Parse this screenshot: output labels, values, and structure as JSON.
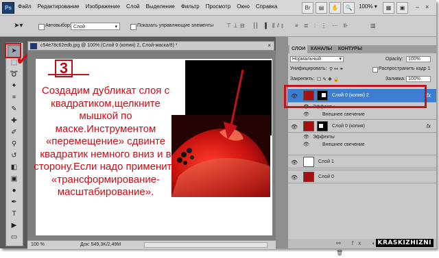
{
  "app": {
    "logo": "Ps"
  },
  "menu": [
    "Файл",
    "Редактирование",
    "Изображение",
    "Слой",
    "Выделение",
    "Фильтр",
    "Просмотр",
    "Окно",
    "Справка"
  ],
  "menubar_right": {
    "zoom": "100%",
    "minimize": "–",
    "close": "×"
  },
  "options": {
    "autoselect_label": "Автовыбор:",
    "autoselect_value": "Слой",
    "show_controls_label": "Показать управляющие элементы"
  },
  "document": {
    "tab_title": "c54e78c62edb.jpg @ 100% (Слой 0 (копия) 2, Слой-маска/8) *",
    "step_number": "3",
    "instruction": "Создадим дубликат слоя с квадратиком,щелкните мышкой по маске.Инструментом «перемещение» сдвинте квадратик немного вниз и в сторону.Если надо примените «трансформирование-масштабирование».",
    "status_zoom": "100 %",
    "status_doc": "Док: 549,3K/2,49M"
  },
  "layers_panel": {
    "tabs": [
      "СЛОИ",
      "КАНАЛЫ",
      "КОНТУРЫ"
    ],
    "blend_mode": "Нормальный",
    "opacity_label": "Opacity:",
    "opacity_value": "100%",
    "unify_label": "Унифицировать:",
    "propagate_label": "Распространить кадр 1",
    "lock_label": "Закрепить:",
    "fill_label": "Заливка:",
    "fill_value": "100%",
    "layers": [
      {
        "name": "Слой 0 (копия) 2",
        "selected": true,
        "fx": "fx"
      },
      {
        "name": "Эффекты",
        "kind": "effects"
      },
      {
        "name": "Внешнее свечение",
        "kind": "effect"
      },
      {
        "name": "Слой 0 (копия)",
        "selected": false,
        "fx": "fx"
      },
      {
        "name": "Эффекты",
        "kind": "effects"
      },
      {
        "name": "Внешнее свечение",
        "kind": "effect"
      },
      {
        "name": "Слой 1",
        "selected": false
      },
      {
        "name": "Слой 0",
        "selected": false
      }
    ]
  },
  "watermark": "KRASKIZHIZNI",
  "colors": {
    "accent_red": "#d10a14",
    "selection_blue": "#3c7fd0"
  }
}
